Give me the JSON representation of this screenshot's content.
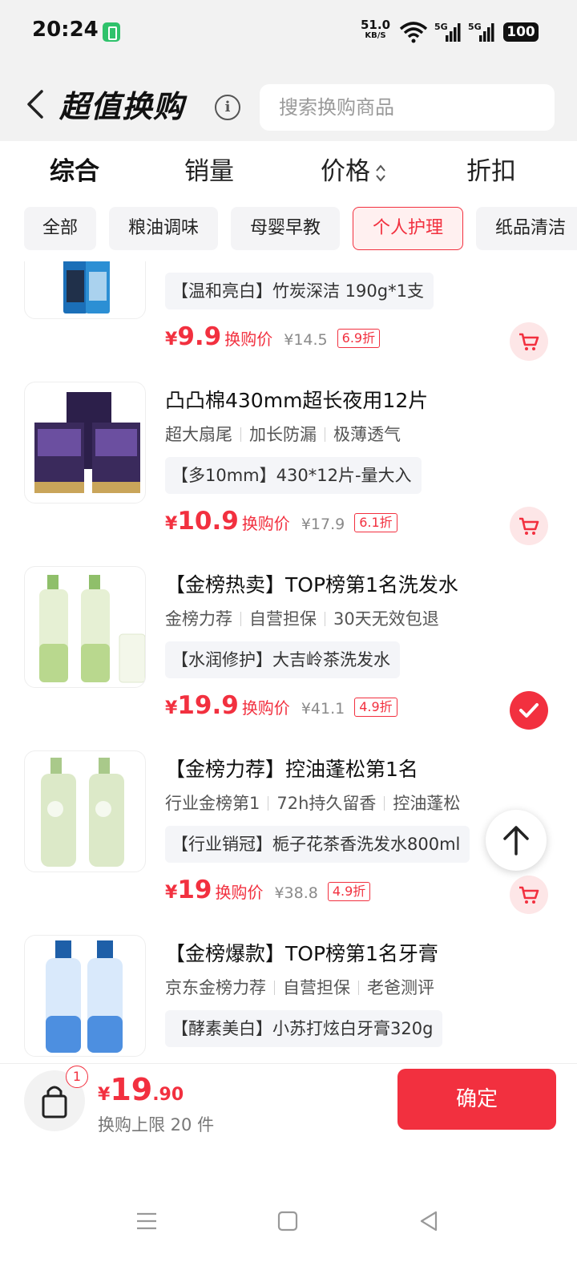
{
  "status_bar": {
    "time": "20:24",
    "speed_value": "51.0",
    "speed_unit": "KB/S",
    "network_1": "5G",
    "network_2": "5G",
    "battery": "100"
  },
  "header": {
    "title": "超值换购",
    "search_placeholder": "搜索换购商品"
  },
  "sort_tabs": [
    {
      "label": "综合",
      "active": true
    },
    {
      "label": "销量",
      "active": false
    },
    {
      "label": "价格",
      "active": false
    },
    {
      "label": "折扣",
      "active": false
    }
  ],
  "categories": [
    {
      "label": "全部",
      "active": false
    },
    {
      "label": "粮油调味",
      "active": false
    },
    {
      "label": "母婴早教",
      "active": false
    },
    {
      "label": "个人护理",
      "active": true
    },
    {
      "label": "纸品清洁",
      "active": false
    }
  ],
  "products": [
    {
      "name": "",
      "tags": [],
      "spec": "【温和亮白】竹炭深洁 190g*1支",
      "price": "9.9",
      "price_label": "换购价",
      "original_price": "¥14.5",
      "discount": "6.9折",
      "selected": false
    },
    {
      "name": "凸凸棉430mm超长夜用12片",
      "tags": [
        "超大扇尾",
        "加长防漏",
        "极薄透气"
      ],
      "spec": "【多10mm】430*12片-量大入",
      "price": "10.9",
      "price_label": "换购价",
      "original_price": "¥17.9",
      "discount": "6.1折",
      "selected": false
    },
    {
      "name": "【金榜热卖】TOP榜第1名洗发水",
      "tags": [
        "金榜力荐",
        "自营担保",
        "30天无效包退"
      ],
      "spec": "【水润修护】大吉岭茶洗发水",
      "price": "19.9",
      "price_label": "换购价",
      "original_price": "¥41.1",
      "discount": "4.9折",
      "selected": true
    },
    {
      "name": "【金榜力荐】控油蓬松第1名",
      "tags": [
        "行业金榜第1",
        "72h持久留香",
        "控油蓬松"
      ],
      "spec": "【行业销冠】栀子花茶香洗发水800ml",
      "price": "19",
      "price_label": "换购价",
      "original_price": "¥38.8",
      "discount": "4.9折",
      "selected": false
    },
    {
      "name": "【金榜爆款】TOP榜第1名牙膏",
      "tags": [
        "京东金榜力荐",
        "自营担保",
        "老爸测评"
      ],
      "spec": "【酵素美白】小苏打炫白牙膏320g",
      "price": "",
      "price_label": "",
      "original_price": "",
      "discount": "",
      "selected": false
    }
  ],
  "bottom_bar": {
    "cart_count": "1",
    "currency": "¥",
    "total_int": "19",
    "total_dec": ".90",
    "limit_text": "换购上限 20 件",
    "confirm_label": "确定"
  },
  "colors": {
    "accent": "#f2303f",
    "chip_bg": "#f4f4f6",
    "header_bg": "#f2f2f2"
  },
  "icons": [
    "back-arrow-icon",
    "info-icon",
    "sort-arrows-icon",
    "cart-icon",
    "check-icon",
    "arrow-up-icon",
    "shopping-bag-icon",
    "menu-icon",
    "home-square-icon",
    "back-triangle-icon"
  ]
}
